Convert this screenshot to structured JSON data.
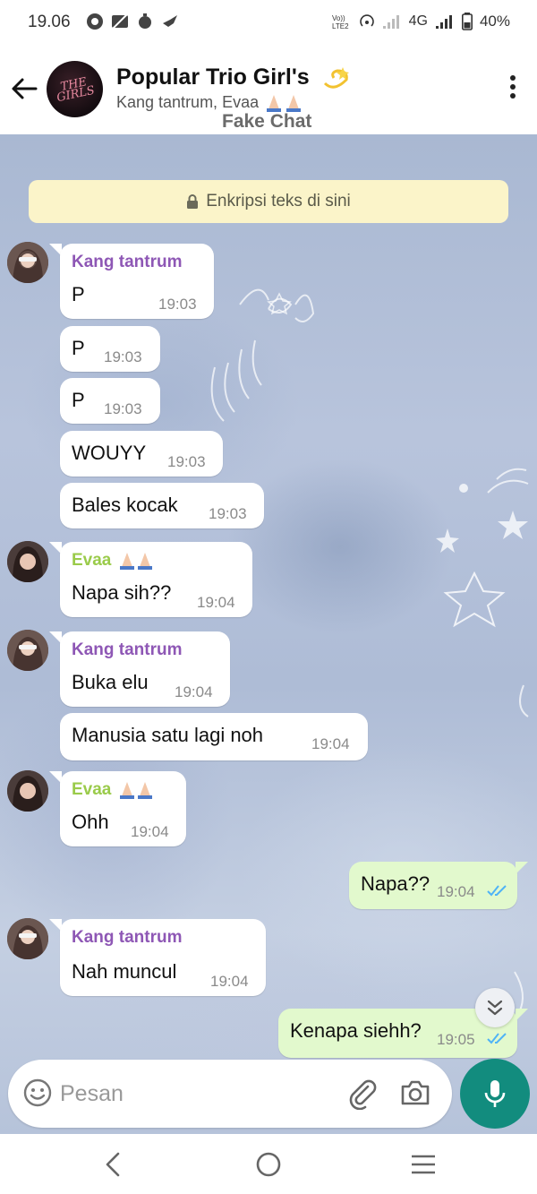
{
  "status_bar": {
    "time": "19.06",
    "network": "4G",
    "battery": "40%"
  },
  "header": {
    "avatar_text": "THE GIRLS",
    "title": "Popular Trio Girl's",
    "title_emoji": "dizzy-emoji",
    "subtitle": "Kang tantrum, Evaa",
    "overlay_text": "Fake Chat"
  },
  "encryption_banner": "Enkripsi teks di sini",
  "messages": [
    {
      "sender": "Kang tantrum",
      "text": "P",
      "time": "19:03"
    },
    {
      "text": "P",
      "time": "19:03"
    },
    {
      "text": "P",
      "time": "19:03"
    },
    {
      "text": "WOUYY",
      "time": "19:03"
    },
    {
      "text": "Bales kocak",
      "time": "19:03"
    },
    {
      "sender": "Evaa",
      "text": "Napa sih??",
      "time": "19:04"
    },
    {
      "sender": "Kang tantrum",
      "text": "Buka elu",
      "time": "19:04"
    },
    {
      "text": "Manusia satu lagi noh",
      "time": "19:04"
    },
    {
      "sender": "Evaa",
      "text": "Ohh",
      "time": "19:04"
    },
    {
      "text": "Napa??",
      "time": "19:04",
      "outgoing": true,
      "status": "read"
    },
    {
      "sender": "Kang tantrum",
      "text": "Nah muncul",
      "time": "19:04"
    },
    {
      "text": "Kenapa siehh?",
      "time": "19:05",
      "outgoing": true,
      "status": "read"
    }
  ],
  "input": {
    "placeholder": "Pesan"
  },
  "colors": {
    "accent": "#128c7e",
    "outgoing_bubble": "#e2f9cd",
    "sender_purple": "#8e57b5",
    "sender_green": "#9acb4a",
    "read_tick": "#4fb3f6",
    "banner": "#fbf4c9"
  },
  "icons": {
    "back": "arrow-left-icon",
    "menu": "more-vertical-icon",
    "lock": "lock-icon",
    "scroll": "double-chevron-down-icon",
    "emoji": "smiley-icon",
    "attach": "paperclip-icon",
    "camera": "camera-icon",
    "mic": "microphone-icon",
    "nav_back": "nav-back-icon",
    "nav_home": "nav-home-icon",
    "nav_recents": "nav-recents-icon"
  }
}
